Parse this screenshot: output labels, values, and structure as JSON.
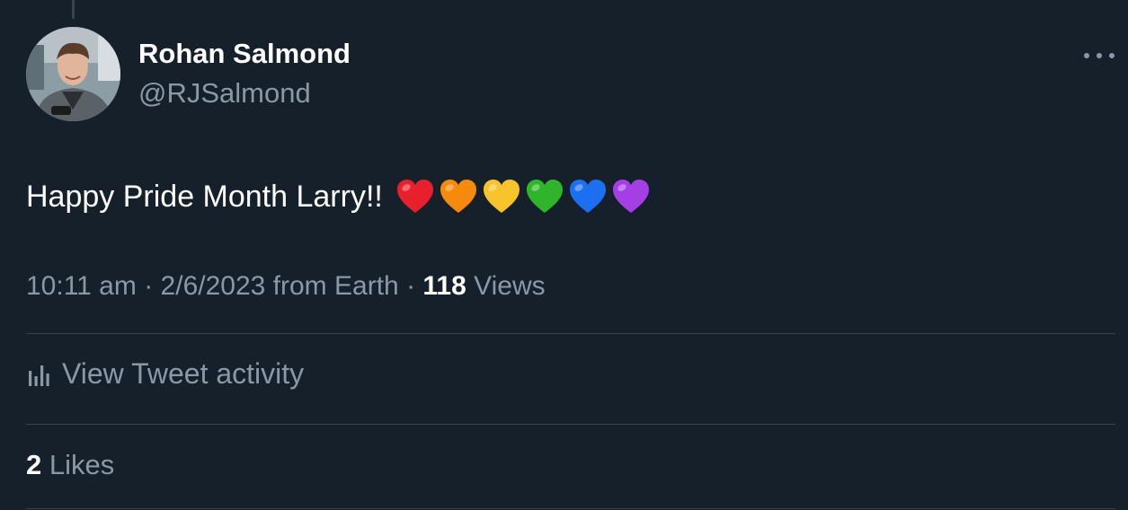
{
  "author": {
    "name": "Rohan Salmond",
    "handle": "@RJSalmond"
  },
  "tweet": {
    "text": "Happy Pride Month Larry!!",
    "hearts": [
      {
        "icon": "red-heart-icon",
        "color": "#e8202e"
      },
      {
        "icon": "orange-heart-icon",
        "color": "#f58a0b"
      },
      {
        "icon": "yellow-heart-icon",
        "color": "#f8c42a"
      },
      {
        "icon": "green-heart-icon",
        "color": "#2fb52a"
      },
      {
        "icon": "blue-heart-icon",
        "color": "#1d6ff2"
      },
      {
        "icon": "purple-heart-icon",
        "color": "#a33fe4"
      }
    ]
  },
  "meta": {
    "time": "10:11 am",
    "separator": "·",
    "date": "2/6/2023",
    "source": "from Earth",
    "views_count": "118",
    "views_label": "Views"
  },
  "activity": {
    "label": "View Tweet activity",
    "icon": "bar-chart-icon"
  },
  "likes": {
    "count": "2",
    "label": "Likes"
  },
  "colors": {
    "background": "#15202b",
    "primary_text": "#ffffff",
    "secondary_text": "#8b98a5",
    "divider": "#38444d"
  }
}
